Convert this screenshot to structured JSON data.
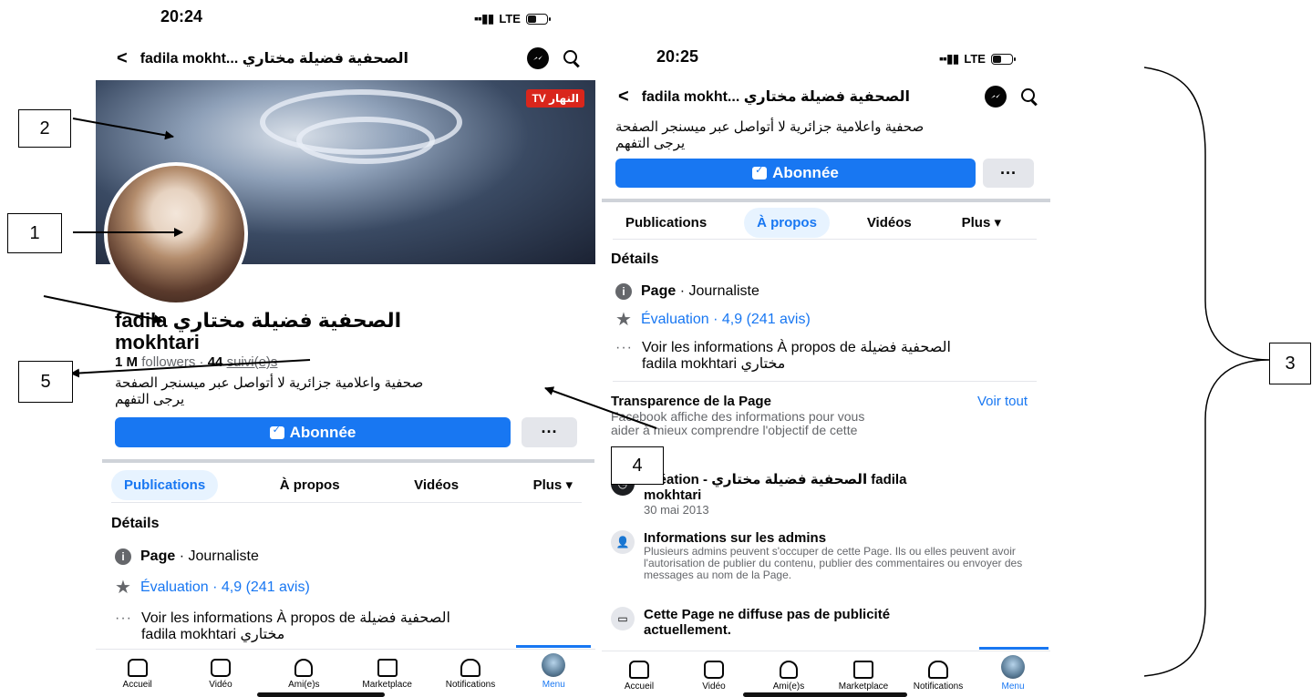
{
  "left": {
    "status_time": "20:24",
    "network": "LTE",
    "header_title": "fadila mokht... الصحفية فضيلة مختاري",
    "cover_logo": "TV النهار",
    "name_line1": "fadila الصحفية فضيلة مختاري",
    "name_line2": "mokhtari",
    "followers_count": "1 M",
    "followers_label": "followers",
    "following_count": "44",
    "following_label": "suivi(e)s",
    "bio_line1": "صحفية واعلامية جزائرية لا أتواصل عبر ميسنجر الصفحة",
    "bio_line2": "يرجى التفهم",
    "subscribed_label": "Abonnée",
    "more_label": "···",
    "tabs": [
      "Publications",
      "À propos",
      "Vidéos",
      "Plus ▾"
    ],
    "details_heading": "Détails",
    "page_label": "Page",
    "page_category": " · Journaliste",
    "rating": "Évaluation · 4,9 (241 avis)",
    "about_line1": "Voir les informations À propos de الصحفية فضيلة",
    "about_line2": "fadila mokhtari مختاري"
  },
  "right": {
    "status_time": "20:25",
    "network": "LTE",
    "header_title": "fadila mokht... الصحفية فضيلة مختاري",
    "bio_line1": "صحفية واعلامية جزائرية لا أتواصل عبر ميسنجر الصفحة",
    "bio_line2": "يرجى التفهم",
    "subscribed_label": "Abonnée",
    "more_label": "···",
    "tabs": [
      "Publications",
      "À propos",
      "Vidéos",
      "Plus ▾"
    ],
    "details_heading": "Détails",
    "page_label": "Page",
    "page_category": " · Journaliste",
    "rating": "Évaluation · 4,9 (241 avis)",
    "about_line1": "Voir les informations À propos de الصحفية فضيلة",
    "about_line2": "fadila mokhtari مختاري",
    "transparency_heading": "Transparence de la Page",
    "see_all": "Voir tout",
    "transparency_desc1": "Facebook affiche des informations pour vous",
    "transparency_desc2": "aider à mieux comprendre l'objectif de cette",
    "creation_title1": "Création - الصحفية فضيلة مختاري fadila",
    "creation_title2": "mokhtari",
    "creation_date": "30 mai 2013",
    "admins_title": "Informations sur les admins",
    "admins_desc": "Plusieurs admins peuvent s'occuper de cette Page. Ils ou elles peuvent avoir l'autorisation de publier du contenu, publier des commentaires ou envoyer des messages au nom de la Page.",
    "ads_title1": "Cette Page ne diffuse pas de publicité",
    "ads_title2": "actuellement."
  },
  "nav": [
    "Accueil",
    "Vidéo",
    "Ami(e)s",
    "Marketplace",
    "Notifications",
    "Menu"
  ],
  "callouts": [
    "1",
    "2",
    "3",
    "4",
    "5"
  ]
}
